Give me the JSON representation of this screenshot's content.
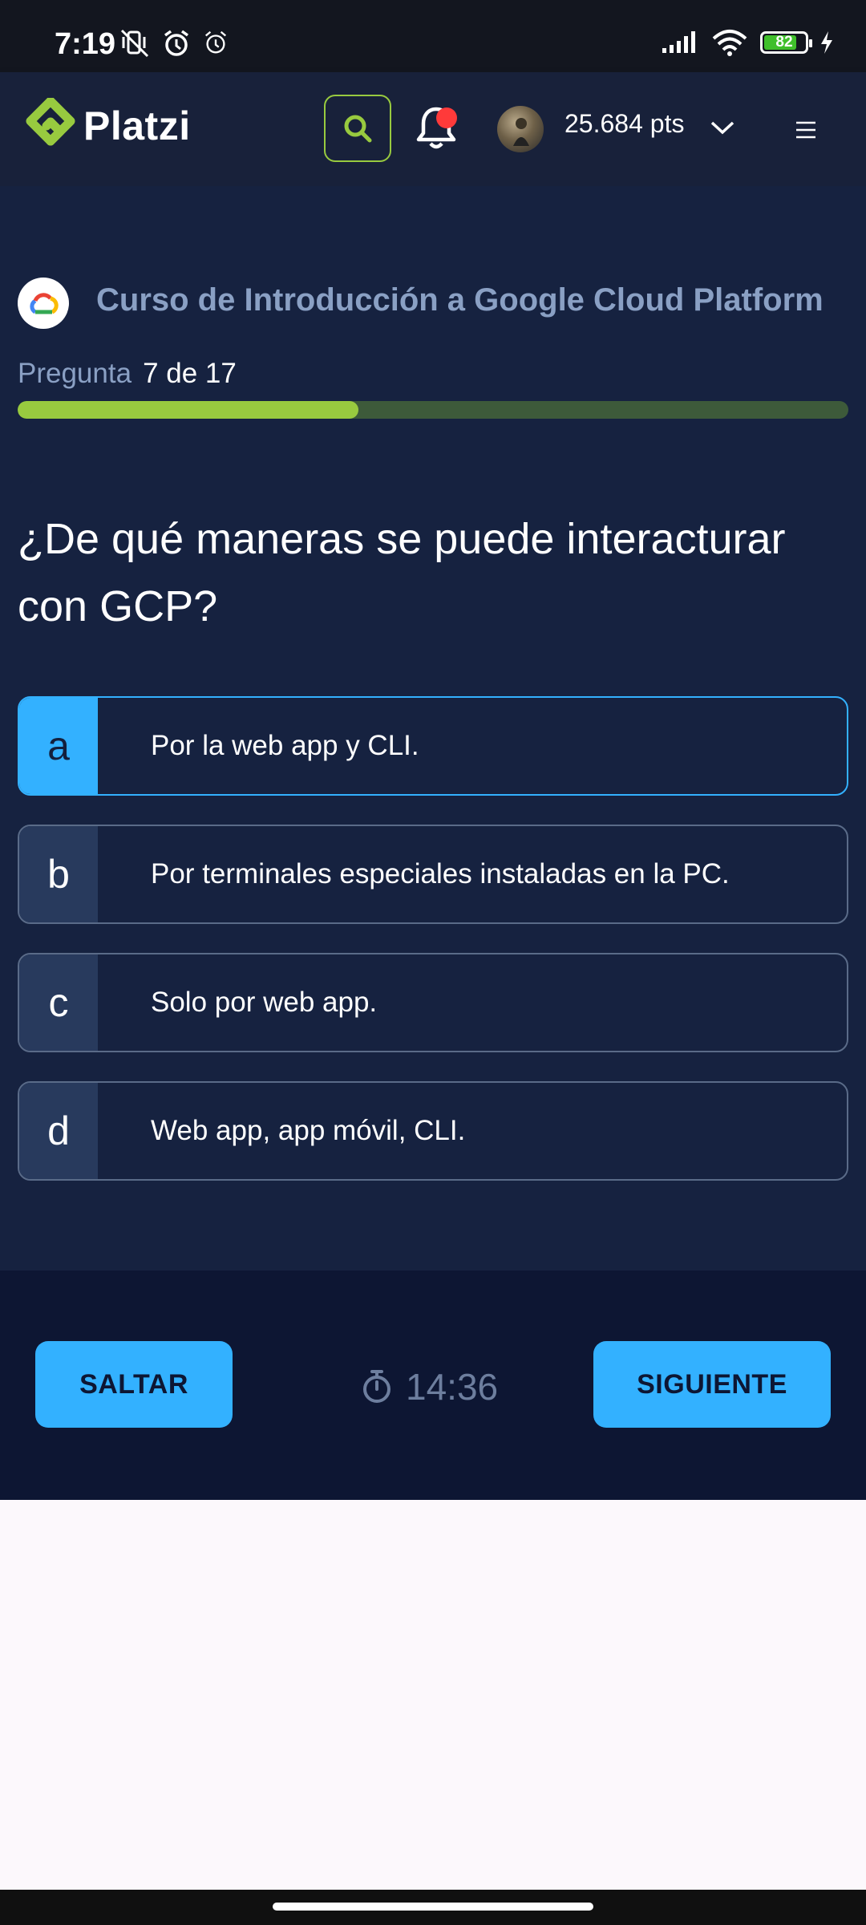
{
  "status_bar": {
    "time": "7:19",
    "battery": "82",
    "battery_level": 0.82,
    "icons": [
      "vibrate-off-icon",
      "alarm-icon",
      "alarm-outline-icon",
      "signal-icon",
      "wifi-icon",
      "battery-icon",
      "charging-icon"
    ]
  },
  "header": {
    "brand": "Platzi",
    "points": "25.684 pts",
    "colors": {
      "bg": "#18213a",
      "accent": "#98ca3f",
      "notification": "#ff3a3a"
    }
  },
  "quiz": {
    "course_title": "Curso de Introducción a Google Cloud Platform",
    "progress_label": "Pregunta",
    "progress_value": "7 de 17",
    "progress_fraction": 0.41,
    "question": "¿De qué maneras se puede interacturar con GCP?",
    "options": [
      {
        "letter": "a",
        "text": "Por la web app y CLI.",
        "selected": true
      },
      {
        "letter": "b",
        "text": "Por terminales especiales instaladas en la PC.",
        "selected": false
      },
      {
        "letter": "c",
        "text": "Solo por web app.",
        "selected": false
      },
      {
        "letter": "d",
        "text": "Web app, app móvil, CLI.",
        "selected": false
      }
    ]
  },
  "footer": {
    "skip_label": "SALTAR",
    "next_label": "SIGUIENTE",
    "timer": "14:36"
  },
  "colors": {
    "page_bg": "#162240",
    "footer_bg": "#0d1633",
    "button": "#33b1ff"
  }
}
